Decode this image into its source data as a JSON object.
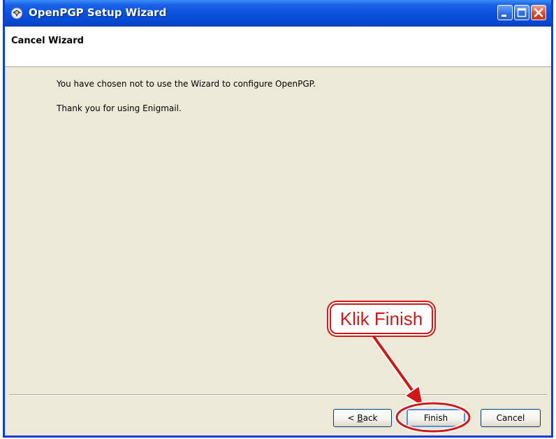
{
  "window": {
    "title": "OpenPGP Setup Wizard",
    "icon": "thunderbird-icon"
  },
  "titlebar_buttons": {
    "minimize_icon": "minimize-icon",
    "maximize_icon": "maximize-icon",
    "close_icon": "close-icon"
  },
  "header": {
    "title": "Cancel Wizard"
  },
  "content": {
    "line1": "You have chosen not to use the Wizard to configure OpenPGP.",
    "line2": "Thank you for using Enigmail."
  },
  "buttons": {
    "back_prefix": "< ",
    "back_mnemonic": "B",
    "back_rest": "ack",
    "finish": "Finish",
    "cancel": "Cancel"
  },
  "annotation": {
    "callout_text": "Klik Finish",
    "color": "#d01818"
  },
  "colors": {
    "titlebar": "#0a52de",
    "dialog_bg": "#ece9d8",
    "accent_red": "#d01818"
  }
}
